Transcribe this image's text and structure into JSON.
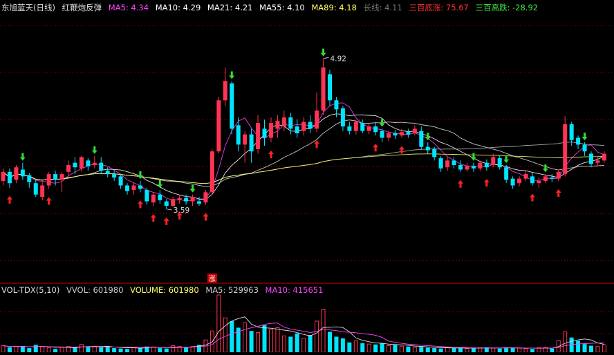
{
  "header": {
    "security": "东旭蓝天(日线)",
    "indicator_name": "红鞭炮反弹",
    "ma": [
      {
        "label": "MA5: 4.34",
        "color": "#ff44ff"
      },
      {
        "label": "MA10: 4.29",
        "color": "#ffffff"
      },
      {
        "label": "MA21: 4.21",
        "color": "#ffffff"
      },
      {
        "label": "MA55: 4.10",
        "color": "#ffffff"
      },
      {
        "label": "MA89: 4.18",
        "color": "#ffff66"
      },
      {
        "label": "长线: 4.11",
        "color": "#777777"
      },
      {
        "label": "三百底涨: 75.67",
        "color": "#ff3333"
      },
      {
        "label": "三百高跌: -28.92",
        "color": "#44ee44"
      }
    ]
  },
  "volume_header": {
    "name": "VOL-TDX(5,10)",
    "items": [
      {
        "label": "VVOL: 601980",
        "color": "#cccccc"
      },
      {
        "label": "VOLUME: 601980",
        "color": "#ffff66"
      },
      {
        "label": "MA5: 529963",
        "color": "#cccccc"
      },
      {
        "label": "MA10: 415651",
        "color": "#ff44ff"
      }
    ]
  },
  "colors": {
    "up": "#ff3355",
    "down": "#00e5ff",
    "buy_arrow": "#ff2222",
    "sell_arrow": "#33dd33",
    "ma5": "#ff44ff",
    "ma10": "#ffffff",
    "ma89": "#ffff66",
    "grid": "#aa0000"
  },
  "chart_data": {
    "type": "candlestick",
    "price_range": [
      3.0,
      5.3
    ],
    "annotations": [
      {
        "text": "4.92",
        "bar": 49,
        "price": 4.92,
        "kind": "high"
      },
      {
        "text": "3.59",
        "bar": 25,
        "price": 3.59,
        "kind": "low"
      }
    ],
    "limit_up_mark": {
      "text": "涨",
      "bar": 32
    },
    "candles": [
      [
        3.84,
        3.92,
        3.8,
        3.95
      ],
      [
        3.92,
        3.82,
        3.78,
        3.95
      ],
      [
        3.85,
        3.96,
        3.82,
        3.98
      ],
      [
        3.94,
        3.88,
        3.85,
        4.0
      ],
      [
        3.89,
        3.83,
        3.78,
        3.91
      ],
      [
        3.82,
        3.72,
        3.7,
        3.85
      ],
      [
        3.7,
        3.8,
        3.67,
        3.83
      ],
      [
        3.8,
        3.9,
        3.77,
        3.92
      ],
      [
        3.9,
        3.85,
        3.8,
        3.93
      ],
      [
        3.85,
        3.9,
        3.74,
        3.92
      ],
      [
        3.92,
        3.98,
        3.88,
        4.02
      ],
      [
        4.0,
        3.96,
        3.9,
        4.05
      ],
      [
        3.95,
        4.05,
        3.92,
        4.06
      ],
      [
        4.02,
        3.97,
        3.93,
        4.04
      ],
      [
        3.98,
        4.0,
        3.95,
        4.06
      ],
      [
        4.0,
        3.93,
        3.9,
        4.05
      ],
      [
        3.93,
        3.9,
        3.87,
        3.96
      ],
      [
        3.9,
        3.87,
        3.84,
        3.93
      ],
      [
        3.88,
        3.8,
        3.77,
        3.9
      ],
      [
        3.8,
        3.75,
        3.72,
        3.82
      ],
      [
        3.76,
        3.8,
        3.72,
        3.83
      ],
      [
        3.8,
        3.77,
        3.74,
        3.84
      ],
      [
        3.76,
        3.66,
        3.63,
        3.78
      ],
      [
        3.65,
        3.72,
        3.62,
        3.74
      ],
      [
        3.72,
        3.67,
        3.64,
        3.76
      ],
      [
        3.66,
        3.62,
        3.59,
        3.68
      ],
      [
        3.62,
        3.68,
        3.61,
        3.7
      ],
      [
        3.67,
        3.69,
        3.64,
        3.72
      ],
      [
        3.69,
        3.66,
        3.63,
        3.72
      ],
      [
        3.66,
        3.7,
        3.62,
        3.72
      ],
      [
        3.66,
        3.64,
        3.62,
        3.7
      ],
      [
        3.65,
        3.74,
        3.63,
        3.76
      ],
      [
        3.74,
        4.1,
        3.72,
        4.12
      ],
      [
        4.1,
        4.55,
        4.08,
        4.58
      ],
      [
        4.55,
        4.72,
        4.5,
        4.84
      ],
      [
        4.7,
        4.3,
        4.25,
        4.72
      ],
      [
        4.33,
        4.16,
        4.1,
        4.4
      ],
      [
        4.16,
        4.25,
        4.0,
        4.28
      ],
      [
        4.25,
        4.1,
        4.0,
        4.3
      ],
      [
        4.12,
        4.35,
        4.08,
        4.42
      ],
      [
        4.3,
        4.22,
        4.15,
        4.38
      ],
      [
        4.22,
        4.35,
        4.18,
        4.4
      ],
      [
        4.3,
        4.37,
        4.22,
        4.42
      ],
      [
        4.32,
        4.4,
        4.28,
        4.46
      ],
      [
        4.4,
        4.3,
        4.25,
        4.44
      ],
      [
        4.32,
        4.26,
        4.22,
        4.38
      ],
      [
        4.28,
        4.36,
        4.24,
        4.4
      ],
      [
        4.36,
        4.3,
        4.26,
        4.42
      ],
      [
        4.3,
        4.46,
        4.27,
        4.62
      ],
      [
        4.46,
        4.84,
        4.42,
        4.92
      ],
      [
        4.78,
        4.55,
        4.5,
        4.82
      ],
      [
        4.55,
        4.47,
        4.4,
        4.58
      ],
      [
        4.48,
        4.32,
        4.28,
        4.5
      ],
      [
        4.32,
        4.28,
        4.25,
        4.36
      ],
      [
        4.28,
        4.36,
        4.25,
        4.38
      ],
      [
        4.35,
        4.28,
        4.26,
        4.38
      ],
      [
        4.28,
        4.32,
        4.25,
        4.35
      ],
      [
        4.32,
        4.27,
        4.24,
        4.36
      ],
      [
        4.28,
        4.22,
        4.18,
        4.3
      ],
      [
        4.22,
        4.26,
        4.19,
        4.28
      ],
      [
        4.26,
        4.24,
        4.21,
        4.29
      ],
      [
        4.24,
        4.27,
        4.22,
        4.3
      ],
      [
        4.27,
        4.25,
        4.22,
        4.3
      ],
      [
        4.26,
        4.3,
        4.24,
        4.33
      ],
      [
        4.28,
        4.14,
        4.12,
        4.32
      ],
      [
        4.14,
        4.11,
        4.08,
        4.18
      ],
      [
        4.12,
        4.05,
        4.02,
        4.14
      ],
      [
        4.04,
        3.95,
        3.92,
        4.06
      ],
      [
        3.96,
        4.02,
        3.93,
        4.05
      ],
      [
        4.02,
        3.98,
        3.95,
        4.05
      ],
      [
        3.98,
        3.94,
        3.92,
        4.02
      ],
      [
        3.94,
        3.97,
        3.92,
        4.0
      ],
      [
        3.97,
        3.95,
        3.92,
        4.0
      ],
      [
        3.95,
        4.0,
        3.93,
        4.02
      ],
      [
        4.0,
        3.96,
        3.93,
        4.03
      ],
      [
        3.98,
        4.05,
        3.96,
        4.08
      ],
      [
        4.04,
        3.96,
        3.94,
        4.06
      ],
      [
        3.96,
        3.85,
        3.82,
        3.98
      ],
      [
        3.86,
        3.8,
        3.77,
        3.88
      ],
      [
        3.82,
        3.86,
        3.79,
        3.88
      ],
      [
        3.86,
        3.9,
        3.84,
        3.93
      ],
      [
        3.88,
        3.82,
        3.8,
        3.92
      ],
      [
        3.82,
        3.84,
        3.78,
        3.87
      ],
      [
        3.84,
        3.88,
        3.82,
        3.9
      ],
      [
        3.87,
        3.86,
        3.83,
        3.9
      ],
      [
        3.86,
        3.92,
        3.84,
        3.94
      ],
      [
        3.9,
        4.34,
        3.88,
        4.41
      ],
      [
        4.34,
        4.2,
        4.15,
        4.36
      ],
      [
        4.22,
        4.16,
        4.12,
        4.24
      ],
      [
        4.16,
        4.1,
        4.06,
        4.18
      ],
      [
        4.08,
        3.99,
        3.96,
        4.1
      ],
      [
        4.0,
        4.02,
        3.97,
        4.06
      ],
      [
        4.02,
        4.08,
        4.0,
        4.1
      ]
    ],
    "volume_range": [
      0,
      760000
    ],
    "volume": [
      80000,
      60000,
      70000,
      75000,
      50000,
      90000,
      70000,
      55000,
      40000,
      60000,
      70000,
      55000,
      95000,
      65000,
      70000,
      60000,
      75000,
      50000,
      45000,
      40000,
      60000,
      55000,
      70000,
      65000,
      50000,
      45000,
      80000,
      70000,
      60000,
      70000,
      90000,
      150000,
      260000,
      700000,
      420000,
      380000,
      300000,
      360000,
      260000,
      240000,
      330000,
      280000,
      300000,
      200000,
      190000,
      230000,
      170000,
      210000,
      380000,
      520000,
      250000,
      190000,
      170000,
      120000,
      140000,
      110000,
      100000,
      95000,
      110000,
      80000,
      90000,
      75000,
      70000,
      60000,
      65000,
      55000,
      50000,
      45000,
      60000,
      50000,
      55000,
      45000,
      50000,
      55000,
      60000,
      50000,
      45000,
      60000,
      55000,
      50000,
      45000,
      40000,
      55000,
      60000,
      45000,
      140000,
      250000,
      180000,
      140000,
      100000,
      80000,
      70000,
      90000
    ]
  }
}
